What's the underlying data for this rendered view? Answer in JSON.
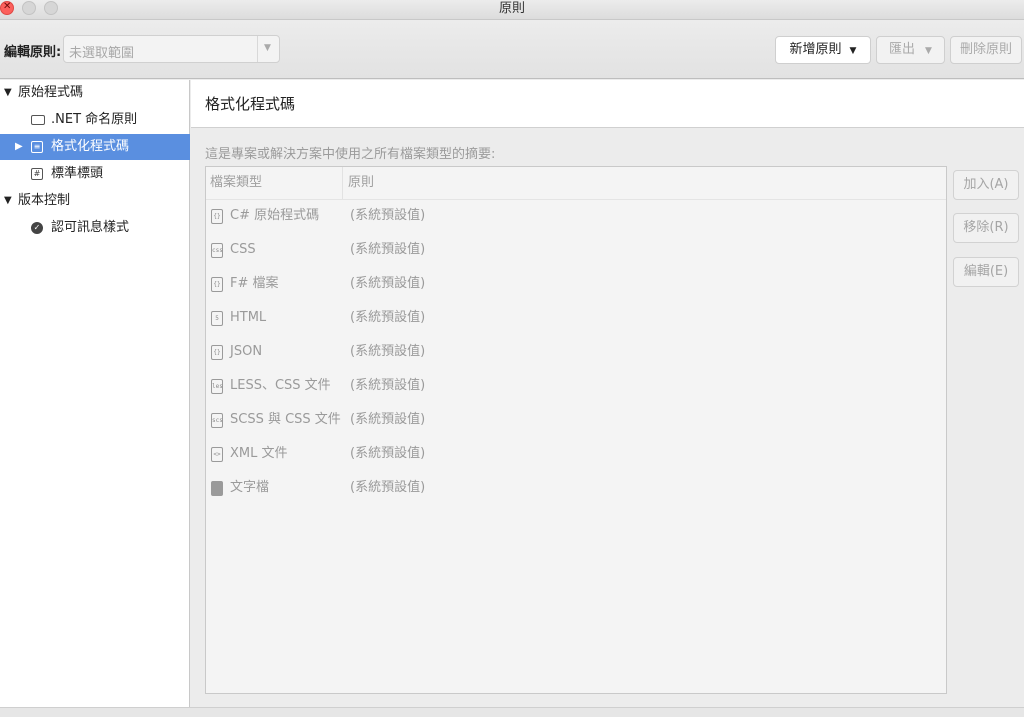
{
  "window": {
    "title": "原則"
  },
  "toolbar": {
    "label": "編輯原則:",
    "scope_placeholder": "未選取範圍",
    "new_button": "新增原則",
    "export_button": "匯出",
    "delete_button": "刪除原則"
  },
  "sidebar": {
    "groups": [
      {
        "label": "原始程式碼",
        "expanded": true
      },
      {
        "label": "版本控制",
        "expanded": true
      }
    ],
    "items": [
      {
        "label": ".NET 命名原則",
        "icon": "naming-icon"
      },
      {
        "label": "格式化程式碼",
        "icon": "formatting-icon",
        "selected": true
      },
      {
        "label": "標準標頭",
        "icon": "hash-icon"
      },
      {
        "label": "認可訊息樣式",
        "icon": "checkmark-circle-icon"
      }
    ]
  },
  "main": {
    "title": "格式化程式碼",
    "summary": "這是專案或解決方案中使用之所有檔案類型的摘要:",
    "columns": {
      "type": "檔案類型",
      "rule": "原則"
    },
    "rows": [
      {
        "name": "C# 原始程式碼",
        "rule": "(系統預設值)",
        "icon": "code-braces-icon",
        "glyph": "{}"
      },
      {
        "name": "CSS",
        "rule": "(系統預設值)",
        "icon": "css-file-icon",
        "glyph": "css"
      },
      {
        "name": "F# 檔案",
        "rule": "(系統預設值)",
        "icon": "code-braces-icon",
        "glyph": "{}"
      },
      {
        "name": "HTML",
        "rule": "(系統預設值)",
        "icon": "html-file-icon",
        "glyph": "5"
      },
      {
        "name": "JSON",
        "rule": "(系統預設值)",
        "icon": "code-braces-icon",
        "glyph": "{}"
      },
      {
        "name": "LESS、CSS 文件",
        "rule": "(系統預設值)",
        "icon": "less-file-icon",
        "glyph": "less"
      },
      {
        "name": "SCSS 與 CSS 文件",
        "rule": "(系統預設值)",
        "icon": "scss-file-icon",
        "glyph": "scss"
      },
      {
        "name": "XML 文件",
        "rule": "(系統預設值)",
        "icon": "xml-file-icon",
        "glyph": "<>"
      },
      {
        "name": "文字檔",
        "rule": "(系統預設值)",
        "icon": "text-file-icon",
        "glyph": ""
      }
    ],
    "buttons": {
      "add": "加入(A)",
      "remove": "移除(R)",
      "edit": "編輯(E)"
    }
  },
  "colors": {
    "selection": "#5a8fe0",
    "close": "#fc605c"
  }
}
